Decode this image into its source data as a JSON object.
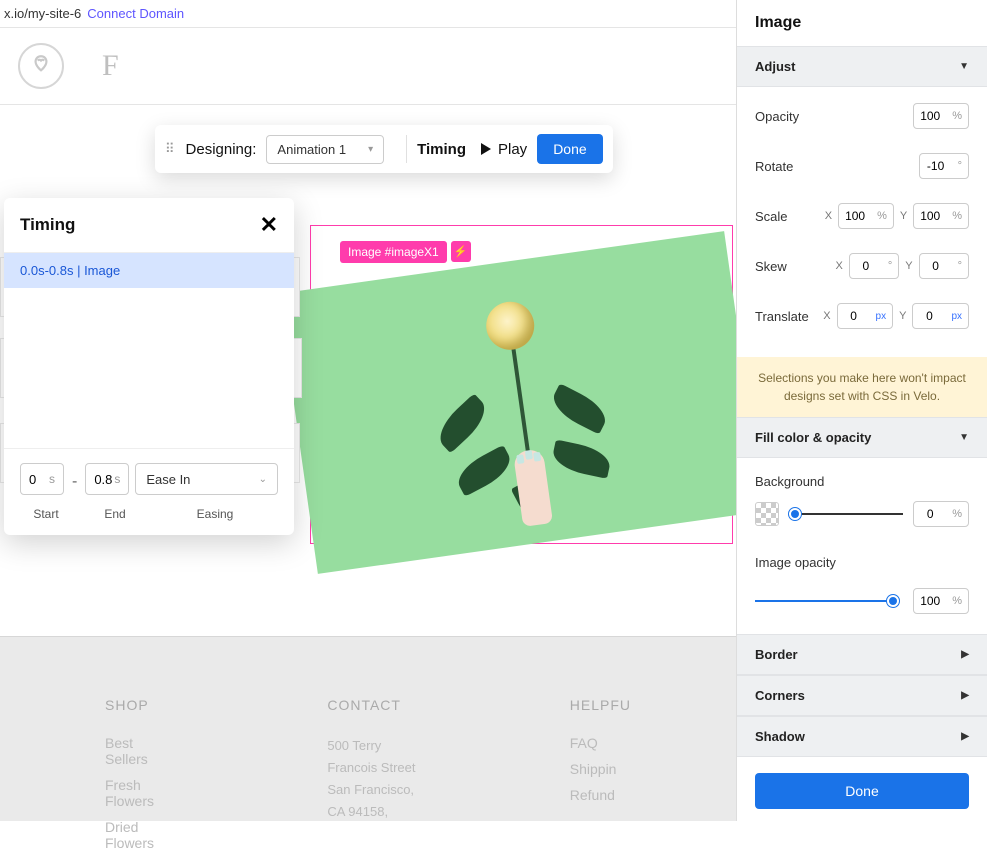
{
  "url": {
    "path": "x.io/my-site-6",
    "connect": "Connect Domain"
  },
  "toolbar": {
    "designing": "Designing:",
    "animation": "Animation 1",
    "timing": "Timing",
    "play": "Play",
    "done": "Done"
  },
  "imageTag": {
    "label": "Image #imageX1",
    "bolt": "⚡"
  },
  "timingPanel": {
    "title": "Timing",
    "item": "0.0s-0.8s | Image",
    "start": "0",
    "end": "0.8",
    "unit": "s",
    "easing": "Ease In",
    "labels": {
      "start": "Start",
      "end": "End",
      "easing": "Easing"
    }
  },
  "footer": {
    "shop": {
      "title": "SHOP",
      "links": [
        "Best Sellers",
        "Fresh Flowers",
        "Dried Flowers"
      ]
    },
    "contact": {
      "title": "CONTACT",
      "lines": [
        "500 Terry Francois Street",
        "San Francisco,",
        "CA 94158,"
      ]
    },
    "helpful": {
      "title": "HELPFU",
      "links": [
        "FAQ",
        "Shippin",
        "Refund "
      ]
    }
  },
  "rightPanel": {
    "title": "Image",
    "adjust": {
      "head": "Adjust",
      "opacity": {
        "label": "Opacity",
        "value": "100",
        "unit": "%"
      },
      "rotate": {
        "label": "Rotate",
        "value": "-10",
        "unit": "°"
      },
      "scale": {
        "label": "Scale",
        "x": "100",
        "y": "100",
        "unit": "%"
      },
      "skew": {
        "label": "Skew",
        "x": "0",
        "y": "0",
        "unit": "°"
      },
      "translate": {
        "label": "Translate",
        "x": "0",
        "y": "0",
        "unit": "px"
      }
    },
    "notice": "Selections you make here won't impact designs set with CSS in Velo.",
    "fill": {
      "head": "Fill color & opacity",
      "bgLabel": "Background",
      "bgValue": "0",
      "bgUnit": "%",
      "imgOpacityLabel": "Image opacity",
      "imgOpacityValue": "100",
      "imgOpacityUnit": "%"
    },
    "collapsed": [
      "Border",
      "Corners",
      "Shadow"
    ],
    "done": "Done"
  }
}
